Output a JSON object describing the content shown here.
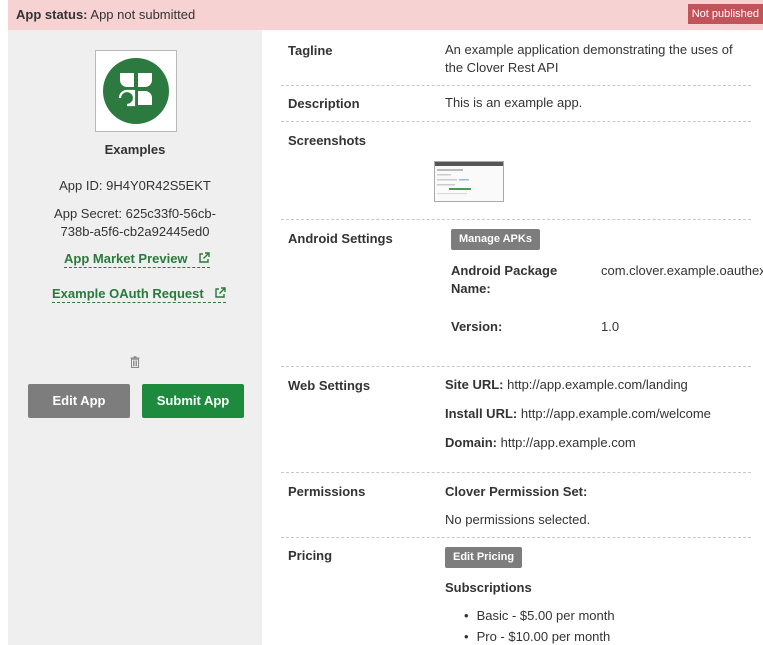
{
  "status": {
    "label": "App status:",
    "value": "App not submitted",
    "badge": "Not published"
  },
  "sidebar": {
    "app_name": "Examples",
    "app_id_label": "App ID:",
    "app_id_value": "9H4Y0R42S5EKT",
    "app_secret_label": "App Secret:",
    "app_secret_value": "625c33f0-56cb-738b-a5f6-cb2a92445ed0",
    "market_preview_link": "App Market Preview",
    "oauth_link": "Example OAuth Request",
    "edit_button": "Edit App",
    "submit_button": "Submit App"
  },
  "details": {
    "tagline_label": "Tagline",
    "tagline_value": "An example application demonstrating the uses of the Clover Rest API",
    "description_label": "Description",
    "description_value": "This is an example app.",
    "screenshots_label": "Screenshots",
    "android_label": "Android Settings",
    "manage_apks_button": "Manage APKs",
    "package_label": "Android Package Name:",
    "package_value": "com.clover.example.oauthex",
    "version_label": "Version:",
    "version_value": "1.0",
    "web_label": "Web Settings",
    "site_url_label": "Site URL:",
    "site_url_value": "http://app.example.com/landing",
    "install_url_label": "Install URL:",
    "install_url_value": "http://app.example.com/welcome",
    "domain_label": "Domain:",
    "domain_value": "http://app.example.com",
    "permissions_label": "Permissions",
    "permission_set_label": "Clover Permission Set:",
    "permissions_value": "No permissions selected.",
    "pricing_label": "Pricing",
    "edit_pricing_button": "Edit Pricing",
    "subscriptions_label": "Subscriptions",
    "subscriptions": [
      "Basic - $5.00 per month",
      "Pro - $10.00 per month"
    ]
  },
  "colors": {
    "status_bar_bg": "#f6d2d3",
    "badge_bg": "#c0545a",
    "brand_green": "#1e8a3d",
    "link_green": "#2a7a3b",
    "sidebar_bg": "#efefef",
    "gray_button": "#7d7d7d"
  },
  "icons": [
    "clover-logo-icon",
    "external-link-icon",
    "trash-icon"
  ]
}
